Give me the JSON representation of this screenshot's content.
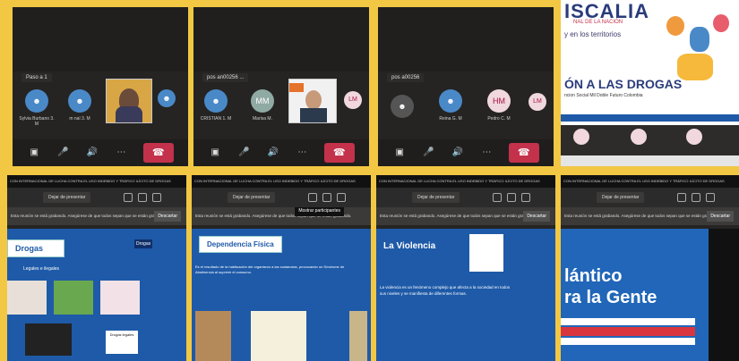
{
  "panels": {
    "p1": {
      "chip": "Paso a 1",
      "avatars": [
        "Sylvia Burbano 3. M",
        "m nal 3. M"
      ]
    },
    "p2": {
      "chip": "pos an00256 ...",
      "avatars": [
        "CRISTIAN 1. M",
        "Marisa M."
      ],
      "initials": [
        "MM",
        "LM"
      ]
    },
    "p3": {
      "chip": "pos a00256",
      "avatars": [
        "Reina G. M",
        "Pedro C. M"
      ],
      "initials": [
        "HM",
        "LM"
      ]
    },
    "p4": {
      "banner_top": "ISCALIA",
      "banner_sub": "NAL DE LA NACIÓN",
      "territorios": "y en los territorios",
      "title": "ÓN A LAS DROGAS",
      "subtitle": "ncion Social Mil Doble Futuro Colombia"
    }
  },
  "bottom": {
    "header_text": "CON INTERNACIONAL DE LUCHA CONTRA EL USO INDEBIDO Y TRÁFICO ILÍCITO DE DROGAS",
    "stop_button": "Dejar de presentar",
    "notice": "Esta reunión se está grabando. Asegúrese de que todos sepan que se están grabando.",
    "dismiss": "Descartar",
    "participants": "Mostrar participantes",
    "slides": [
      {
        "title": "Drogas",
        "sub": "Legales e ilegales",
        "badge": "Drogas",
        "small_text": "Drogas legales"
      },
      {
        "title": "Dependencia Física",
        "body": "Es el resultado de la habituación del organismo a las sustancias, provocando un Síndrome de Abstinencia al suprimir el consumo."
      },
      {
        "title": "La Violencia",
        "body": "La violencia es un fenómeno complejo que afecta a la sociedad en todos sus niveles y se manifiesta de diferentes formas."
      },
      {
        "title_line1": "lántico",
        "title_line2": "ra la Gente"
      }
    ]
  }
}
